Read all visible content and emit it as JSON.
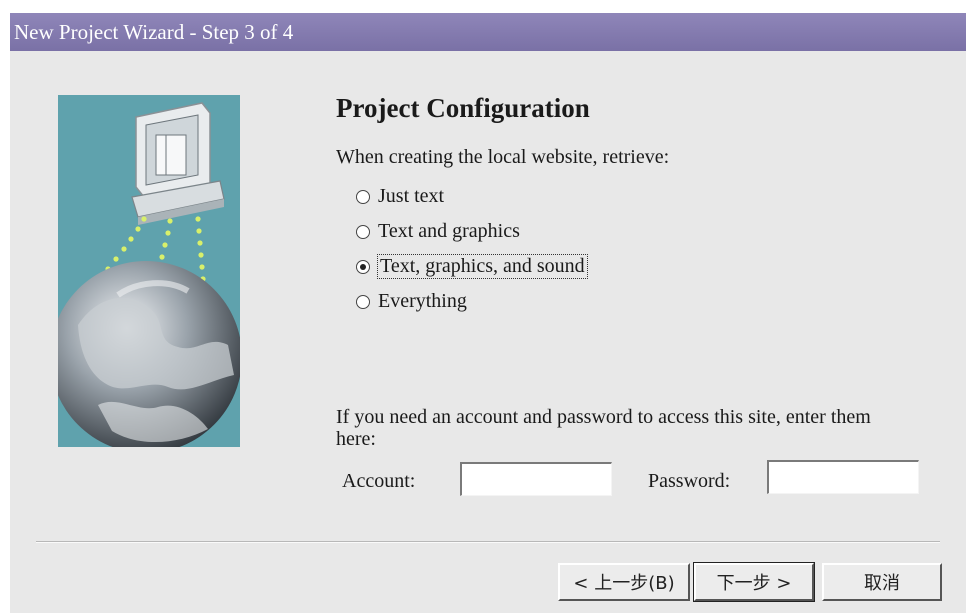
{
  "window": {
    "title": "New Project Wizard - Step 3 of 4"
  },
  "page": {
    "heading": "Project Configuration",
    "prompt": "When creating the local website, retrieve:"
  },
  "retrieve_options": [
    {
      "label": "Just text",
      "selected": false
    },
    {
      "label": "Text and graphics",
      "selected": false
    },
    {
      "label": "Text, graphics, and sound",
      "selected": true
    },
    {
      "label": "Everything",
      "selected": false
    }
  ],
  "account_section": {
    "note": "If you need an account and password to access this site, enter them here:",
    "account_label": "Account:",
    "account_value": "",
    "password_label": "Password:",
    "password_value": ""
  },
  "buttons": {
    "back": "< 上一步(B)",
    "next": "下一步 >",
    "cancel": "取消"
  },
  "icons": {
    "side_image": "computer-globe-illustration"
  },
  "colors": {
    "titlebar": "#7a71a6",
    "dialog_bg": "#e8e8e8",
    "illustration_bg": "#5fa2ad"
  }
}
